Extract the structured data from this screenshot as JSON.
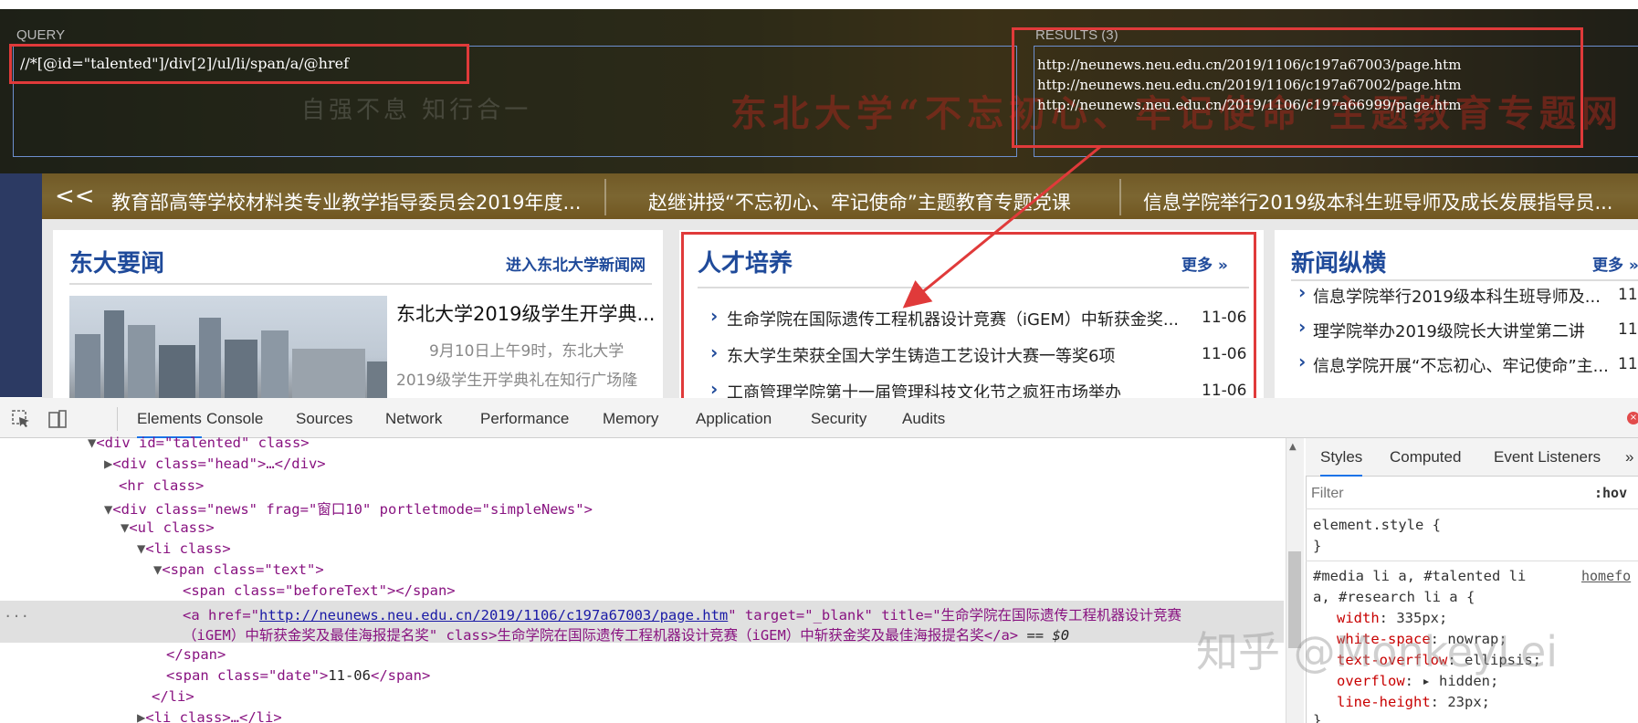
{
  "xpath_helper": {
    "query_label": "QUERY",
    "query": "//*[@id=\"talented\"]/div[2]/ul/li/span/a/@href",
    "results_label": "RESULTS (3)",
    "results": [
      "http://neunews.neu.edu.cn/2019/1106/c197a67003/page.htm",
      "http://neunews.neu.edu.cn/2019/1106/c197a67002/page.htm",
      "http://neunews.neu.edu.cn/2019/1106/c197a66999/page.htm"
    ]
  },
  "hero": {
    "title": "东北大学“不忘初心、牢记使命”主题教育专题网",
    "motto": "自强不息 知行合一"
  },
  "ticker": {
    "arrow": "<<",
    "items": [
      "教育部高等学校材料类专业教学指导委员会2019年度...",
      "赵继讲授“不忘初心、牢记使命”主题教育专题党课",
      "信息学院举行2019级本科生班导师及成长发展指导员..."
    ]
  },
  "card_news": {
    "title": "东大要闻",
    "more": "进入东北大学新闻网",
    "headline": "东北大学2019级学生开学典...",
    "summary": [
      "9月10日上午9时，东北大学",
      "2019级学生开学典礼在知行广场隆"
    ]
  },
  "card_talent": {
    "title": "人才培养",
    "more": "更多",
    "items": [
      {
        "text": "生命学院在国际遗传工程机器设计竞赛（iGEM）中斩获金奖...",
        "date": "11-06"
      },
      {
        "text": "东大学生荣获全国大学生铸造工艺设计大赛一等奖6项",
        "date": "11-06"
      },
      {
        "text": "工商管理学院第十一届管理科技文化节之疯狂市场举办",
        "date": "11-06"
      }
    ]
  },
  "card_media": {
    "title": "新闻纵横",
    "more": "更多",
    "items": [
      {
        "text": "信息学院举行2019级本科生班导师及...",
        "date": "11-"
      },
      {
        "text": "理学院举办2019级院长大讲堂第二讲",
        "date": "11-"
      },
      {
        "text": "信息学院开展“不忘初心、牢记使命”主...",
        "date": "11-"
      }
    ]
  },
  "devtools": {
    "tabs": [
      "Elements",
      "Console",
      "Sources",
      "Network",
      "Performance",
      "Memory",
      "Application",
      "Security",
      "Audits"
    ],
    "active_tab": "Elements",
    "dom": {
      "l0_tag": "<div id=\"talented\" class>",
      "l1": "<div class=\"head\">…</div>",
      "l2": "<hr class>",
      "l3_a": "<div class=\"news\" frag=\"窗口10\" portletmode=\"simpleNews\">",
      "l4": "<ul class>",
      "l5": "<li class>",
      "l6": "<span class=\"text\">",
      "l7": "<span class=\"beforeText\"></span>",
      "l8_prefix": "<a href=\"",
      "l8_href": "http://neunews.neu.edu.cn/2019/1106/c197a67003/page.htm",
      "l8_mid": "\" target=\"_blank\" title=\"生命学院在国际遗传工程机器设计竞赛",
      "l9": "（iGEM）中斩获金奖及最佳海报提名奖\" class>生命学院在国际遗传工程机器设计竞赛（iGEM）中斩获金奖及最佳海报提名奖</a>",
      "l9_sel": " == $0",
      "l10": "</span>",
      "l11_a": "<span class=\"date\">",
      "l11_b": "11-06",
      "l11_c": "</span>",
      "l12": "</li>",
      "l13": "<li class>…</li>",
      "ellipsis": "..."
    },
    "styles_tabs": [
      "Styles",
      "Computed",
      "Event Listeners",
      "»"
    ],
    "filter_placeholder": "Filter",
    "hov": ":hov",
    "element_style": "element.style {",
    "close_brace": "}",
    "media_rule_1": "#media li a, #talented li",
    "media_rule_2": "a, #research li a {",
    "source": "homefo",
    "props": [
      {
        "name": "width",
        "value": "335px;"
      },
      {
        "name": "white-space",
        "value": "nowrap;"
      },
      {
        "name": "text-overflow",
        "value": "ellipsis;"
      },
      {
        "name": "overflow",
        "value": "▸ hidden;"
      },
      {
        "name": "line-height",
        "value": "23px;"
      }
    ]
  },
  "watermark": "知乎 @MonkeyLei",
  "colors": {
    "highlight_red": "#e03a3a",
    "link_blue": "#1f4a9a",
    "devtools_active": "#1a73e8"
  }
}
